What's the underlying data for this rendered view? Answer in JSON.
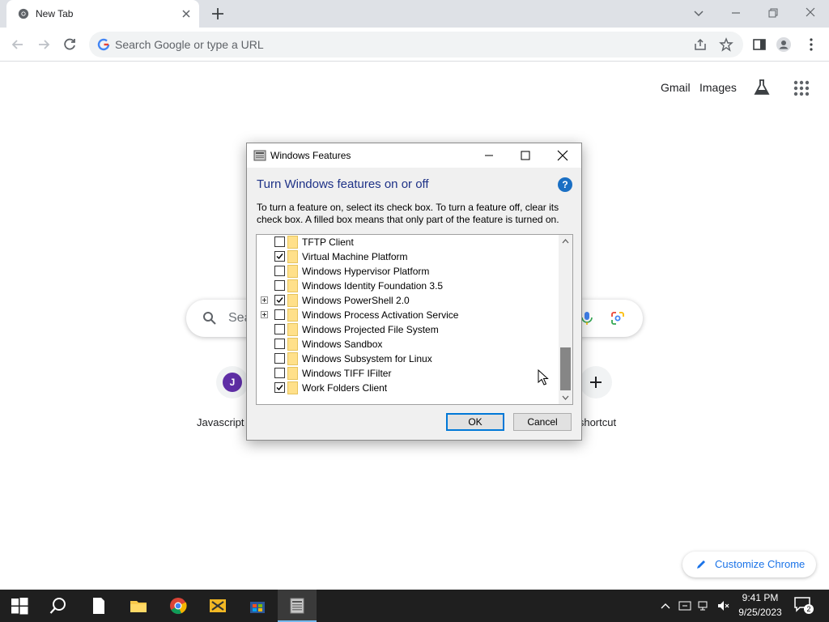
{
  "browser": {
    "tab_title": "New Tab",
    "omnibox_placeholder": "Search Google or type a URL"
  },
  "ntp": {
    "gmail_link": "Gmail",
    "images_link": "Images",
    "search_placeholder": "Sea",
    "shortcuts": [
      {
        "label": "Javascript",
        "avatar_letter": "J"
      },
      {
        "label": "d shortcut"
      }
    ],
    "customize_label": "Customize Chrome"
  },
  "dialog": {
    "title": "Windows Features",
    "heading": "Turn Windows features on or off",
    "help_glyph": "?",
    "description": "To turn a feature on, select its check box. To turn a feature off, clear its check box. A filled box means that only part of the feature is turned on.",
    "features": [
      {
        "label": "TFTP Client",
        "checked": false,
        "expandable": false
      },
      {
        "label": "Virtual Machine Platform",
        "checked": true,
        "expandable": false
      },
      {
        "label": "Windows Hypervisor Platform",
        "checked": false,
        "expandable": false
      },
      {
        "label": "Windows Identity Foundation 3.5",
        "checked": false,
        "expandable": false
      },
      {
        "label": "Windows PowerShell 2.0",
        "checked": true,
        "expandable": true
      },
      {
        "label": "Windows Process Activation Service",
        "checked": false,
        "expandable": true
      },
      {
        "label": "Windows Projected File System",
        "checked": false,
        "expandable": false
      },
      {
        "label": "Windows Sandbox",
        "checked": false,
        "expandable": false
      },
      {
        "label": "Windows Subsystem for Linux",
        "checked": false,
        "expandable": false
      },
      {
        "label": "Windows TIFF IFilter",
        "checked": false,
        "expandable": false
      },
      {
        "label": "Work Folders Client",
        "checked": true,
        "expandable": false
      }
    ],
    "ok_label": "OK",
    "cancel_label": "Cancel"
  },
  "taskbar": {
    "time": "9:41 PM",
    "date": "9/25/2023",
    "notification_count": "2"
  },
  "colors": {
    "dialog_heading": "#1e3287",
    "chrome_accent": "#1a73e8",
    "taskbar_bg": "#1f1f1f"
  }
}
